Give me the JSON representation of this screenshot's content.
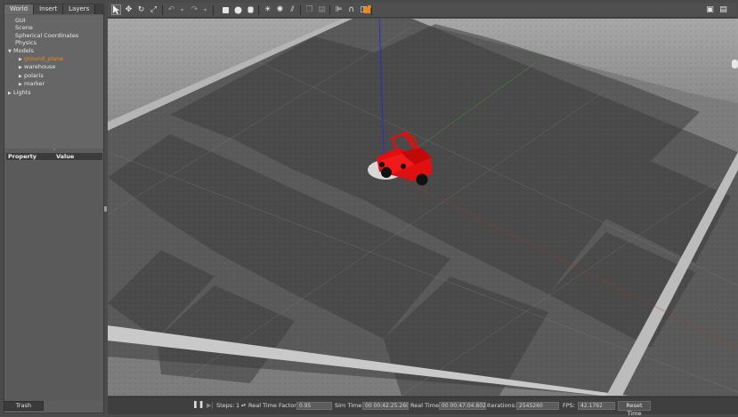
{
  "tabs": [
    {
      "label": "World"
    },
    {
      "label": "Insert"
    },
    {
      "label": "Layers"
    }
  ],
  "tree": {
    "gui": "GUI",
    "scene": "Scene",
    "spherical": "Spherical Coordinates",
    "physics": "Physics",
    "models": "Models",
    "model_items": [
      "ground_plane",
      "warehouse",
      "polaris",
      "marker"
    ],
    "lights": "Lights"
  },
  "properties": {
    "col_property": "Property",
    "col_value": "Value"
  },
  "trash_label": "Trash",
  "toolbar": {
    "icons": [
      "select-arrow-icon",
      "translate-icon",
      "rotate-icon",
      "scale-icon",
      "undo-icon",
      "undo-dropdown-icon",
      "redo-icon",
      "redo-dropdown-icon",
      "box-icon",
      "sphere-icon",
      "cylinder-icon",
      "point-light-icon",
      "spot-light-icon",
      "directional-light-icon",
      "copy-icon",
      "paste-icon",
      "align-icon",
      "snap-icon",
      "view-angle-icon",
      "screenshot-icon",
      "log-icon"
    ]
  },
  "bottom": {
    "steps_label": "Steps:",
    "steps_value": "1",
    "rtf_label": "Real Time Factor:",
    "rtf_value": "0.95",
    "sim_time_label": "Sim Time:",
    "sim_time_value": "00 00:42:25.260",
    "real_time_label": "Real Time:",
    "real_time_value": "00 00:47:04.802",
    "iterations_label": "Iterations:",
    "iterations_value": "2545260",
    "fps_label": "FPS:",
    "fps_value": "42.1792",
    "reset_label": "Reset Time"
  },
  "colors": {
    "selected_item": "#f08a18",
    "vehicle": "#e01010",
    "toolbar_accent": "#f0851a"
  }
}
